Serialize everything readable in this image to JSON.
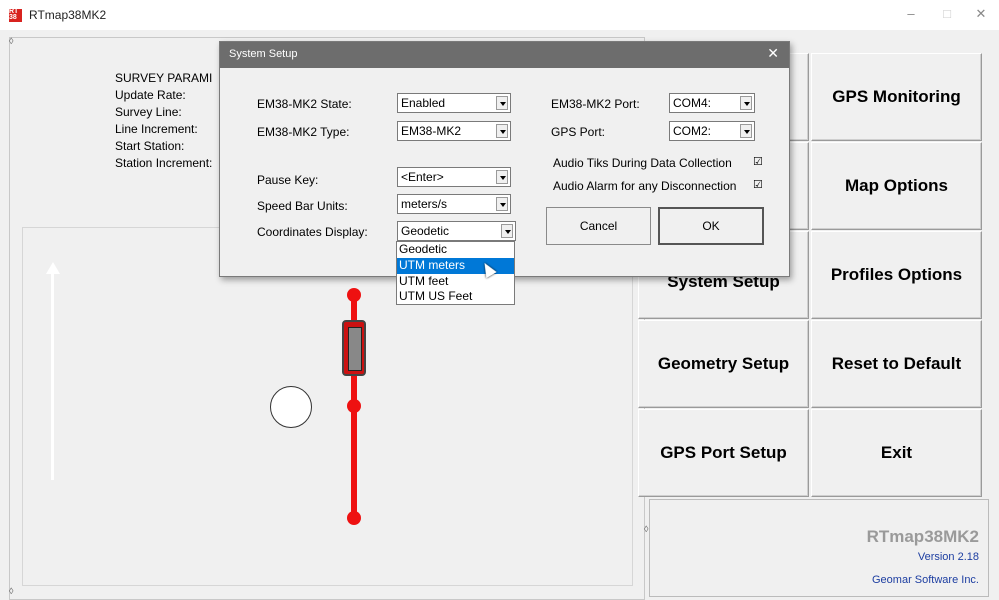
{
  "window": {
    "title": "RTmap38MK2",
    "icon": "app-logo-icon",
    "minimize": "–",
    "maximize": "□",
    "close": "✕"
  },
  "survey": {
    "lines": [
      "SURVEY PARAMI",
      "Update Rate:",
      "Survey Line:",
      "Line Increment:",
      "Start Station:",
      "Station Increment:"
    ]
  },
  "right_buttons": [
    {
      "label": "GPS Monitoring"
    },
    {
      "label": "Map Options"
    },
    {
      "label": "System Setup"
    },
    {
      "label": "Profiles Options"
    },
    {
      "label": "Geometry Setup"
    },
    {
      "label": "Reset to Default"
    },
    {
      "label": "GPS Port Setup"
    },
    {
      "label": "Exit"
    }
  ],
  "info": {
    "app_name": "RTmap38MK2",
    "version": "Version 2.18",
    "company": "Geomar Software Inc."
  },
  "dialog": {
    "title": "System Setup",
    "close": "✕",
    "fields": {
      "state_label": "EM38-MK2 State:",
      "state_value": "Enabled",
      "type_label": "EM38-MK2 Type:",
      "type_value": "EM38-MK2",
      "pause_label": "Pause Key:",
      "pause_value": "<Enter>",
      "speed_label": "Speed Bar Units:",
      "speed_value": "meters/s",
      "coords_label": "Coordinates Display:",
      "coords_value": "Geodetic",
      "port_label": "EM38-MK2 Port:",
      "port_value": "COM4:",
      "gps_port_label": "GPS Port:",
      "gps_port_value": "COM2:",
      "audio_tiks_label": "Audio Tiks During Data Collection",
      "audio_alarm_label": "Audio Alarm for any Disconnection",
      "check_mark": "☑"
    },
    "buttons": {
      "cancel": "Cancel",
      "ok": "OK"
    },
    "coords_options": [
      "Geodetic",
      "UTM meters",
      "UTM feet",
      "UTM US Feet"
    ],
    "coords_highlighted": "UTM meters"
  },
  "colors": {
    "dialog_title_bg": "#6d6d6d",
    "selection": "#0078d7",
    "profile_red": "#ee1111",
    "link_blue": "#1d3ea1"
  }
}
